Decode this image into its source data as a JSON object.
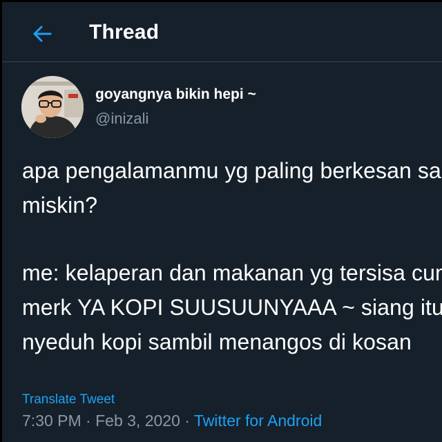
{
  "header": {
    "back_icon": "arrow-left-icon",
    "title": "Thread"
  },
  "colors": {
    "background": "#15202b",
    "accent": "#1da1f2",
    "secondary_text": "#8899a6",
    "divider": "#38444d"
  },
  "tweet": {
    "author": {
      "display_name": "goyangnya bikin hepi ~",
      "handle": "@inizali"
    },
    "text_lines": [
      "apa pengalamanmu yg paling berkesan saat",
      "miskin?",
      "me: kelaperan dan makanan yg tersisa cuma",
      "merk YA KOPI SUUSUUNYAAA ~ siang itu gw",
      "nyeduh kopi sambil menangos di kosan"
    ],
    "translate_label": "Translate Tweet",
    "time": "7:30 PM",
    "separator": "·",
    "date": "Feb 3, 2020",
    "source": "Twitter for Android"
  }
}
